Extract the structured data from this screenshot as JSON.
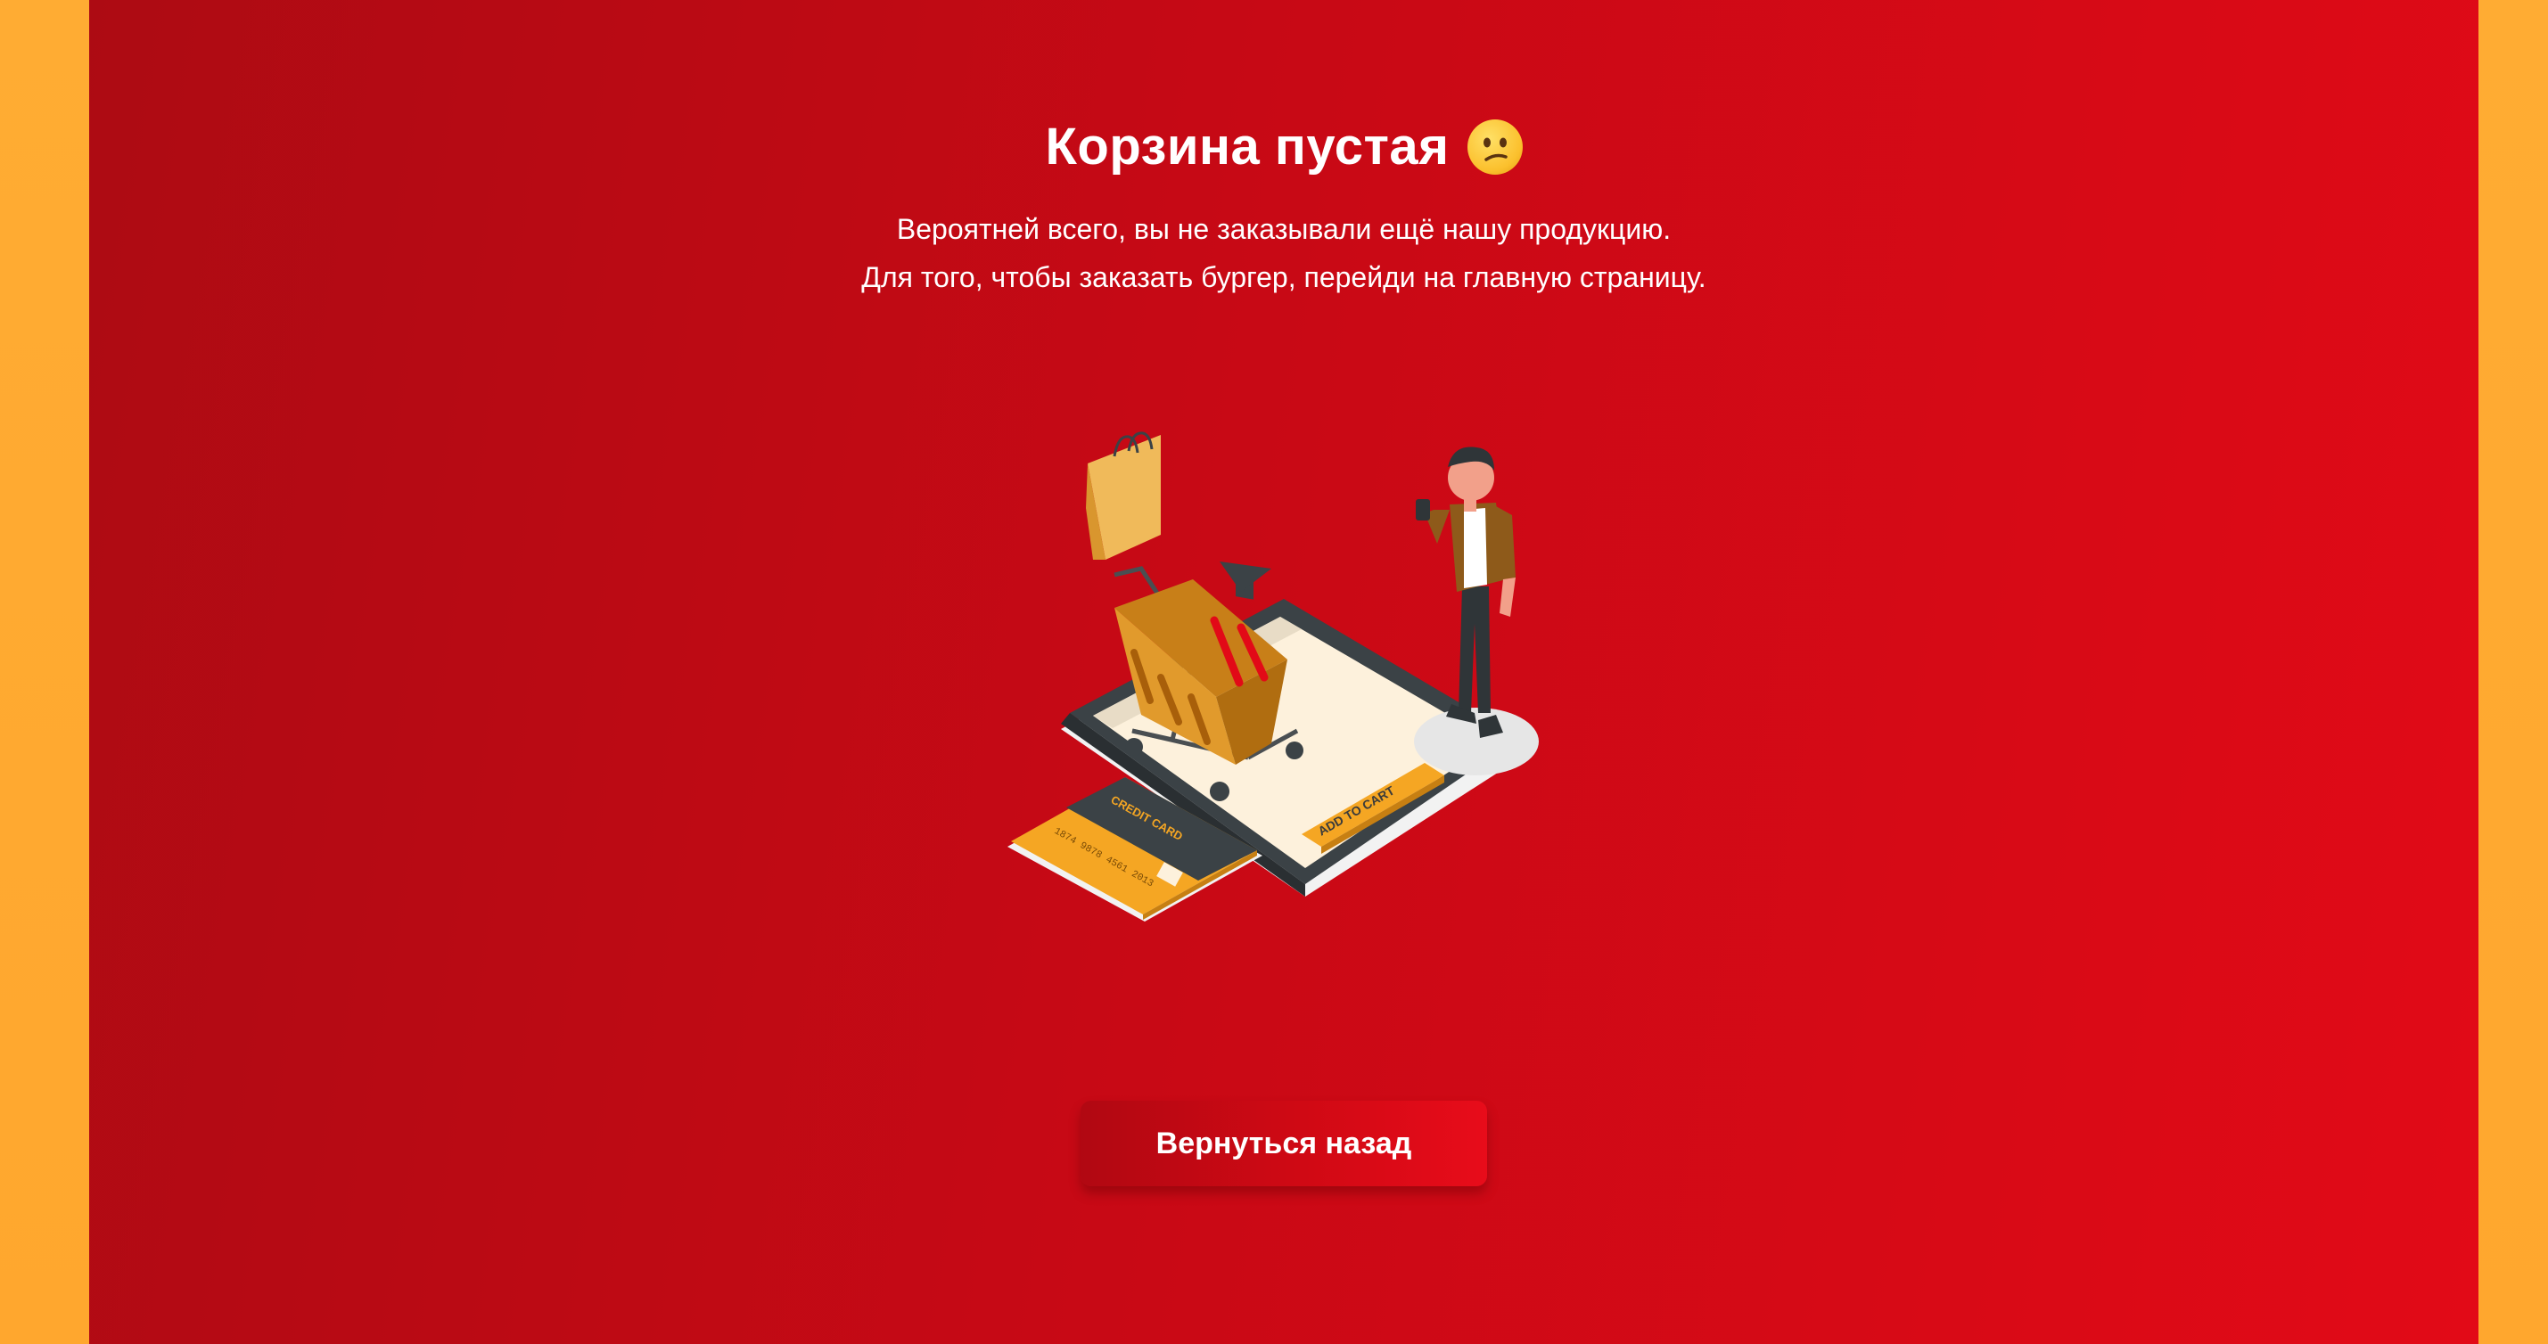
{
  "page": {
    "title": "Корзина пустая",
    "title_emoji": "confused-face-icon",
    "subtitle_line_1": "Вероятней всего, вы не заказывали ещё нашу продукцию.",
    "subtitle_line_2": "Для того, чтобы заказать бургер, перейди на главную страницу."
  },
  "illustration": {
    "card_label": "CREDIT CARD",
    "card_number": "1874  9878  4561  2013",
    "phone_button_label": "ADD TO CART"
  },
  "actions": {
    "back_label": "Вернуться назад"
  },
  "colors": {
    "side_panel": "#ffa831",
    "main_red": "#d00914",
    "button_red": "#c40913",
    "text": "#ffffff",
    "accent_orange": "#f5a623"
  }
}
